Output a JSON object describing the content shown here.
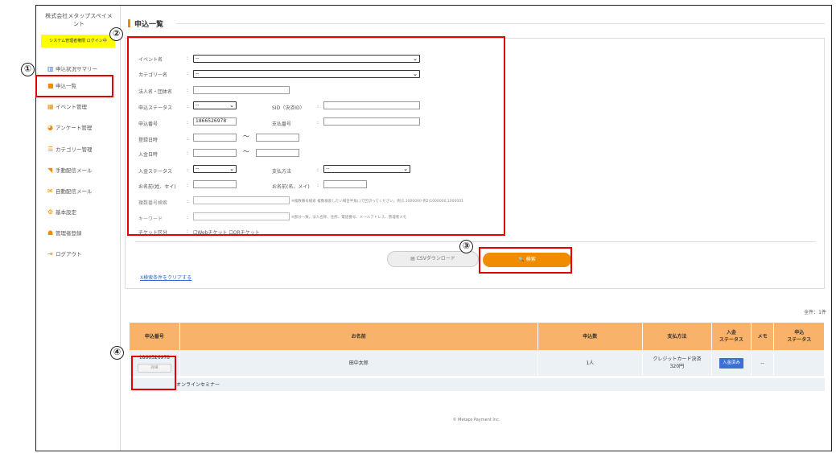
{
  "sidebar": {
    "company": "株式会社メタップスペイメント",
    "login_status": "システム管理者権限 ログイン中",
    "items": [
      {
        "label": "申込状況サマリー",
        "icon": "bar-chart-icon"
      },
      {
        "label": "申込一覧",
        "icon": "book-icon"
      },
      {
        "label": "イベント管理",
        "icon": "grid-icon"
      },
      {
        "label": "アンケート管理",
        "icon": "pie-chart-icon"
      },
      {
        "label": "カテゴリー管理",
        "icon": "list-icon"
      },
      {
        "label": "手動配信メール",
        "icon": "rss-icon"
      },
      {
        "label": "自動配信メール",
        "icon": "mail-icon"
      },
      {
        "label": "基本設定",
        "icon": "cog-icon"
      },
      {
        "label": "管理者登録",
        "icon": "users-icon"
      },
      {
        "label": "ログアウト",
        "icon": "logout-icon"
      }
    ]
  },
  "page_title": "申込一覧",
  "form": {
    "colon": ":",
    "tilde": "～",
    "event_label": "イベント名",
    "event_value": "--",
    "category_label": "カテゴリー名",
    "category_value": "--",
    "group_label": "法人名・団体名",
    "app_status_label": "申込ステータス",
    "app_status_value": "--",
    "sid_label": "SID（決済ID）",
    "app_no_label": "申込番号",
    "app_no_value": "1866526978",
    "pay_no_label": "支払番号",
    "reg_date_label": "登録日時",
    "deposit_date_label": "入金日時",
    "deposit_status_label": "入金ステータス",
    "deposit_status_value": "--",
    "pay_method_label": "支払方法",
    "pay_method_value": "--",
    "name_kana_label": "お名前(姓、セイ)",
    "name_mei_label": "お名前(名、メイ)",
    "multi_app_label": "複数番号検索",
    "multi_app_note": "※複数番号検索 複数検索したい場合半角(,)で区切ってください。例)1,1000000 例2)1000000,1000001",
    "keyword_label": "キーワード",
    "keyword_note": "※部分一致。法人名称、住所、電話番号、メールアドレス、管理者メモ",
    "ticket_label": "チケット区分",
    "ticket_web": "Webチケット",
    "ticket_qr": "QRチケット",
    "csv_button": "CSVダウンロード",
    "search_button": "検索",
    "clear_link": "X検索条件をクリアする"
  },
  "results": {
    "count": "全件：1件",
    "headers": [
      "申込番号",
      "お名前",
      "申込数",
      "支払方法",
      "入金ステータス",
      "メモ",
      "申込ステータス"
    ],
    "rows": [
      {
        "app_no": "1866526978",
        "detail": "詳細",
        "name": "田中太郎",
        "qty": "1人",
        "pay_method": "クレジットカード決済",
        "amount": "320円",
        "deposit_status": "入金済み",
        "memo": "--",
        "app_status": "",
        "event_name": "オンラインセミナー"
      }
    ]
  },
  "footer": "© Metaps Payment Inc.",
  "annotations": [
    "①",
    "②",
    "③",
    "④"
  ],
  "colors": {
    "accent": "#f08c00",
    "header_bg": "#f9b26a",
    "highlight": "#e60000",
    "paid_badge": "#3b6fd4",
    "login_badge": "#ffff00"
  }
}
